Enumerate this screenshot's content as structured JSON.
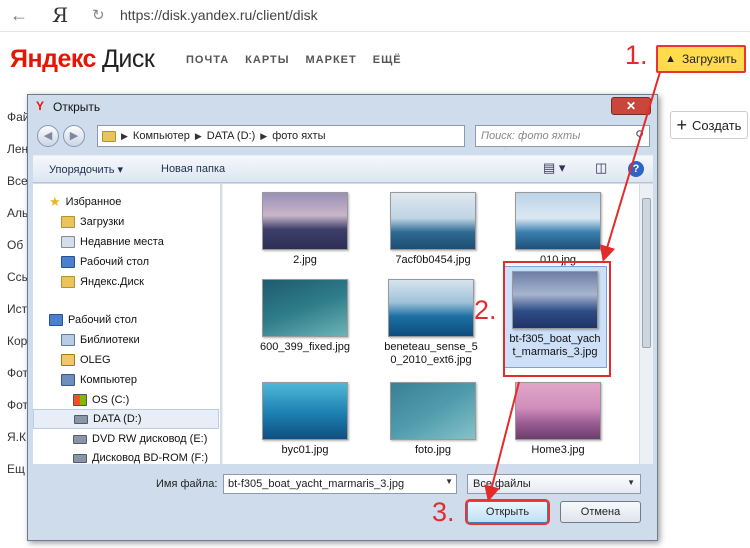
{
  "browser": {
    "url": "https://disk.yandex.ru/client/disk"
  },
  "header": {
    "logo_part1": "Яндекс",
    "logo_part2": "Диск",
    "nav": [
      "ПОЧТА",
      "КАРТЫ",
      "МАРКЕТ",
      "ЕЩЁ"
    ],
    "upload_label": "Загрузить",
    "create_label": "Создать"
  },
  "sidebar_peek": [
    "Фай",
    "Лен",
    "Все",
    "Аль",
    "Об",
    "Ссы",
    "Ист",
    "Кор",
    "Фот",
    "Фот",
    "Я.К",
    "Ещ"
  ],
  "steps": [
    "1.",
    "2.",
    "3."
  ],
  "dialog": {
    "title": "Открыть",
    "close_symbol": "✕",
    "path": [
      "Компьютер",
      "DATA (D:)",
      "фото яхты"
    ],
    "search_placeholder": "Поиск: фото яхты",
    "toolbar": {
      "organize": "Упорядочить",
      "new_folder": "Новая папка"
    },
    "nav_items": [
      {
        "label": "Избранное",
        "icon": "star-icon"
      },
      {
        "label": "Загрузки",
        "icon": "folder-icon"
      },
      {
        "label": "Недавние места",
        "icon": "recent-places-icon"
      },
      {
        "label": "Рабочий стол",
        "icon": "desktop-icon"
      },
      {
        "label": "Яндекс.Диск",
        "icon": "folder-icon"
      },
      {
        "label": "Рабочий стол",
        "icon": "desktop-icon"
      },
      {
        "label": "Библиотеки",
        "icon": "libraries-icon"
      },
      {
        "label": "OLEG",
        "icon": "user-folder-icon"
      },
      {
        "label": "Компьютер",
        "icon": "computer-icon"
      },
      {
        "label": "OS (C:)",
        "icon": "windows-drive-icon"
      },
      {
        "label": "DATA (D:)",
        "icon": "drive-icon"
      },
      {
        "label": "DVD RW дисковод (E:)",
        "icon": "dvd-drive-icon"
      },
      {
        "label": "Дисковод BD-ROM (F:)",
        "icon": "bd-drive-icon"
      }
    ],
    "files": [
      {
        "name": "2.jpg"
      },
      {
        "name": "7acf0b0454.jpg"
      },
      {
        "name": "010.jpg"
      },
      {
        "name": "600_399_fixed.jpg"
      },
      {
        "name": "beneteau_sense_50_2010_ext6.jpg"
      },
      {
        "name": "bt-f305_boat_yacht_marmaris_3.jpg"
      },
      {
        "name": "byc01.jpg"
      },
      {
        "name": "foto.jpg"
      },
      {
        "name": "Home3.jpg"
      }
    ],
    "file_name_label": "Имя файла:",
    "file_name_value": "bt-f305_boat_yacht_marmaris_3.jpg",
    "file_type": "Все файлы",
    "open_label": "Открыть",
    "cancel_label": "Отмена"
  },
  "colors": {
    "upload_bg": "#ffdb4d",
    "annotation_red": "#e42b2b",
    "brand_red": "#e61400"
  }
}
